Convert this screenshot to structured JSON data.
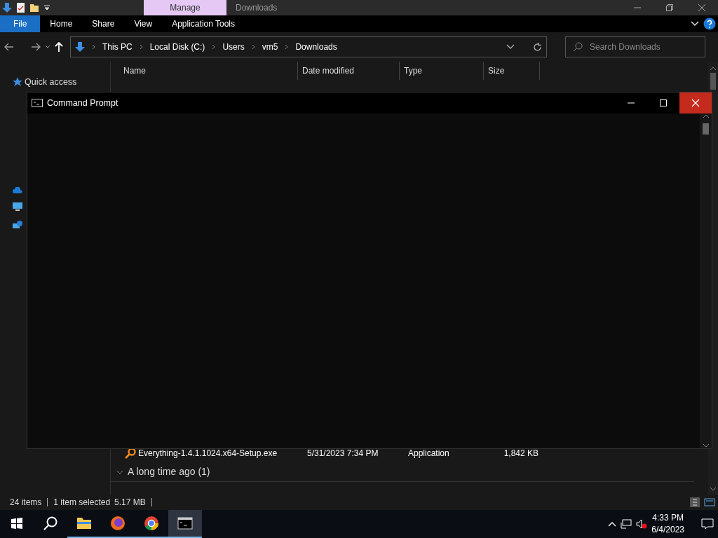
{
  "explorer": {
    "title_bar": {
      "context_tab": "Manage",
      "title": "Downloads"
    },
    "ribbon_tabs": [
      {
        "label": "File",
        "kind": "file"
      },
      {
        "label": "Home",
        "kind": "tab"
      },
      {
        "label": "Share",
        "kind": "tab"
      },
      {
        "label": "View",
        "kind": "tab"
      },
      {
        "label": "Application Tools",
        "kind": "tab"
      }
    ],
    "breadcrumb": [
      "This PC",
      "Local Disk (C:)",
      "Users",
      "vm5",
      "Downloads"
    ],
    "search": {
      "placeholder": "Search Downloads"
    },
    "nav_pane": {
      "items": [
        {
          "label": "Quick access"
        }
      ]
    },
    "columns": [
      "Name",
      "Date modified",
      "Type",
      "Size"
    ],
    "list": [
      {
        "kind": "file",
        "name": "Everything-1.4.1.1024.x64-Setup.exe",
        "date": "5/31/2023 7:34 PM",
        "type": "Application",
        "size": "1,842 KB"
      },
      {
        "kind": "group",
        "label": "A long time ago (1)"
      }
    ],
    "status_bar": {
      "item_count": "24 items",
      "selection": "1 item selected",
      "size": "5.17 MB"
    }
  },
  "cmd_window": {
    "title": "Command Prompt"
  },
  "taskbar": {
    "apps": [
      {
        "kind": "folder",
        "running": true,
        "selected": false
      },
      {
        "kind": "firefox",
        "running": true,
        "selected": false
      },
      {
        "kind": "chrome",
        "running": true,
        "selected": false
      },
      {
        "kind": "cmd",
        "running": true,
        "selected": true
      }
    ],
    "time": "4:33 PM",
    "date": "6/4/2023"
  }
}
